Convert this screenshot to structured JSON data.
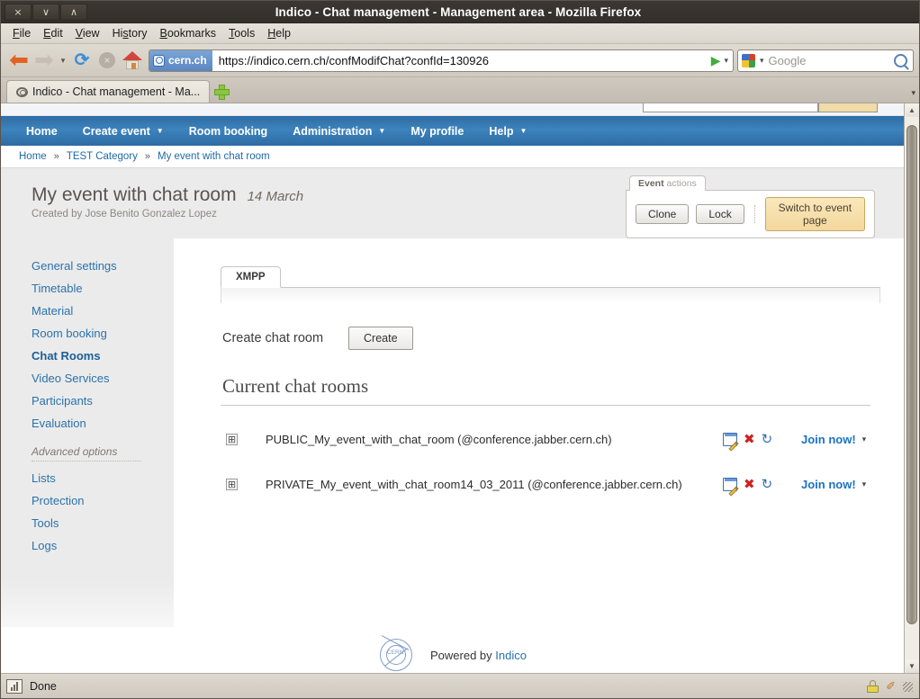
{
  "browser": {
    "window_title": "Indico - Chat management - Management area - Mozilla Firefox",
    "window_buttons": {
      "close": "×",
      "minimize": "∨",
      "maximize": "∧"
    },
    "menus": [
      "File",
      "Edit",
      "View",
      "History",
      "Bookmarks",
      "Tools",
      "Help"
    ],
    "toolbar": {
      "back_icon": "back-arrow-icon",
      "forward_icon": "forward-arrow-icon",
      "history_caret": "▾",
      "reload_icon": "⟳",
      "stop_icon": "×",
      "home_icon": "home-icon",
      "go_icon": "▶",
      "url_caret": "▾"
    },
    "url": {
      "site_identity": "cern.ch",
      "address": "https://indico.cern.ch/confModifChat?confId=130926"
    },
    "search": {
      "engine": "google-icon",
      "placeholder": "Google",
      "caret": "▾",
      "magnifier": "search-icon"
    },
    "tab": {
      "title": "Indico - Chat management - Ma...",
      "new_tab_label": "+",
      "tab_list_caret": "▾"
    },
    "status": {
      "text": "Done",
      "security_icon": "lock-icon",
      "writing_icon": "✐"
    }
  },
  "site": {
    "nav": [
      {
        "label": "Home",
        "has_caret": false
      },
      {
        "label": "Create event",
        "has_caret": true
      },
      {
        "label": "Room booking",
        "has_caret": false
      },
      {
        "label": "Administration",
        "has_caret": true
      },
      {
        "label": "My profile",
        "has_caret": false
      },
      {
        "label": "Help",
        "has_caret": true
      }
    ],
    "breadcrumb": {
      "separator": "»",
      "items": [
        "Home",
        "TEST Category",
        "My event with chat room"
      ]
    },
    "event": {
      "title": "My event with chat room",
      "date": "14 March",
      "creator": "Created by Jose Benito Gonzalez Lopez"
    },
    "event_actions": {
      "tab_bold": "Event",
      "tab_light": "actions",
      "buttons": [
        "Clone",
        "Lock"
      ],
      "primary_button": "Switch to event page"
    },
    "sidebar": {
      "items": [
        {
          "label": "General settings",
          "active": false
        },
        {
          "label": "Timetable",
          "active": false
        },
        {
          "label": "Material",
          "active": false
        },
        {
          "label": "Room booking",
          "active": false
        },
        {
          "label": "Chat Rooms",
          "active": true
        },
        {
          "label": "Video Services",
          "active": false
        },
        {
          "label": "Participants",
          "active": false
        },
        {
          "label": "Evaluation",
          "active": false
        }
      ],
      "advanced_label": "Advanced options",
      "advanced_items": [
        {
          "label": "Lists"
        },
        {
          "label": "Protection"
        },
        {
          "label": "Tools"
        },
        {
          "label": "Logs"
        }
      ]
    },
    "content": {
      "tab": "XMPP",
      "create_label": "Create chat room",
      "create_button": "Create",
      "section_title": "Current chat rooms",
      "rooms": [
        {
          "expand": "⊞",
          "name": "PUBLIC_My_event_with_chat_room (@conference.jabber.cern.ch)",
          "edit_icon": "edit-icon",
          "delete_icon": "✖",
          "refresh_icon": "↻",
          "join_label": "Join now!",
          "join_caret": "▾"
        },
        {
          "expand": "⊞",
          "name": "PRIVATE_My_event_with_chat_room14_03_2011 (@conference.jabber.cern.ch)",
          "edit_icon": "edit-icon",
          "delete_icon": "✖",
          "refresh_icon": "↻",
          "join_label": "Join now!",
          "join_caret": "▾"
        }
      ]
    },
    "footer": {
      "logo": "cern-logo",
      "logo_text": "CERN",
      "powered_by": "Powered by",
      "product": "Indico"
    }
  },
  "colors": {
    "nav_blue": "#3d83bd",
    "link_blue": "#2a72ad",
    "accent_gold": "#f3d89d",
    "delete_red": "#cc2222"
  }
}
